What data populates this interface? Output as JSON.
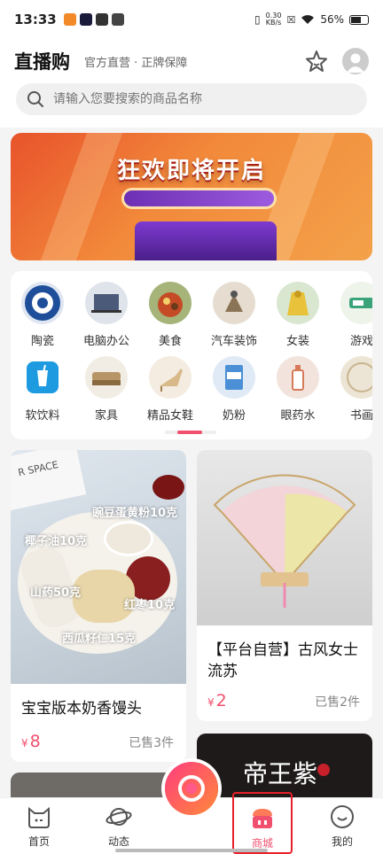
{
  "status_bar": {
    "time": "13:33",
    "network_speed": "0.30",
    "network_unit": "KB/s",
    "battery": "56%"
  },
  "header": {
    "title": "直播购",
    "subtitle": "官方直营 · 正牌保障",
    "star_icon": "star-icon",
    "avatar_icon": "user-avatar-icon"
  },
  "search": {
    "placeholder": "请输入您要搜索的商品名称"
  },
  "banner": {
    "title": "狂欢即将开启"
  },
  "categories": {
    "row1": [
      {
        "label": "陶瓷",
        "color": "#1e4d9a"
      },
      {
        "label": "电脑办公",
        "color": "#4a5a78"
      },
      {
        "label": "美食",
        "color": "#c44b25"
      },
      {
        "label": "汽车装饰",
        "color": "#8a7456"
      },
      {
        "label": "女装",
        "color": "#e8c23a"
      },
      {
        "label": "游戏",
        "color": "#3aa37a"
      }
    ],
    "row2": [
      {
        "label": "软饮料",
        "color": "#1e9be0"
      },
      {
        "label": "家具",
        "color": "#b89566"
      },
      {
        "label": "精品女鞋",
        "color": "#d8b98a"
      },
      {
        "label": "奶粉",
        "color": "#4b8fd6"
      },
      {
        "label": "眼药水",
        "color": "#d77a5a"
      },
      {
        "label": "书画",
        "color": "#c9b48f"
      }
    ],
    "scroll_progress": 0.48
  },
  "products": [
    {
      "title": "宝宝版本奶香馒头",
      "currency": "¥",
      "price": "8",
      "sold": "已售3件",
      "img_space": "R SPACE",
      "img_labels": [
        "豌豆蛋黄粉10克",
        "椰子油10克",
        "山药50克",
        "红枣10克",
        "西瓜籽仁15克"
      ]
    },
    {
      "title": "【平台自营】古风女士流苏",
      "currency": "¥",
      "price": "2",
      "sold": "已售2件"
    },
    {
      "img_text": "帝王紫"
    }
  ],
  "bottom_nav": {
    "items": [
      {
        "label": "首页",
        "icon": "home-icon"
      },
      {
        "label": "动态",
        "icon": "planet-icon"
      },
      {
        "label": "商城",
        "icon": "shop-icon"
      },
      {
        "label": "我的",
        "icon": "profile-icon"
      }
    ],
    "center_icon": "camera-icon",
    "active_color": "#f0506e"
  }
}
